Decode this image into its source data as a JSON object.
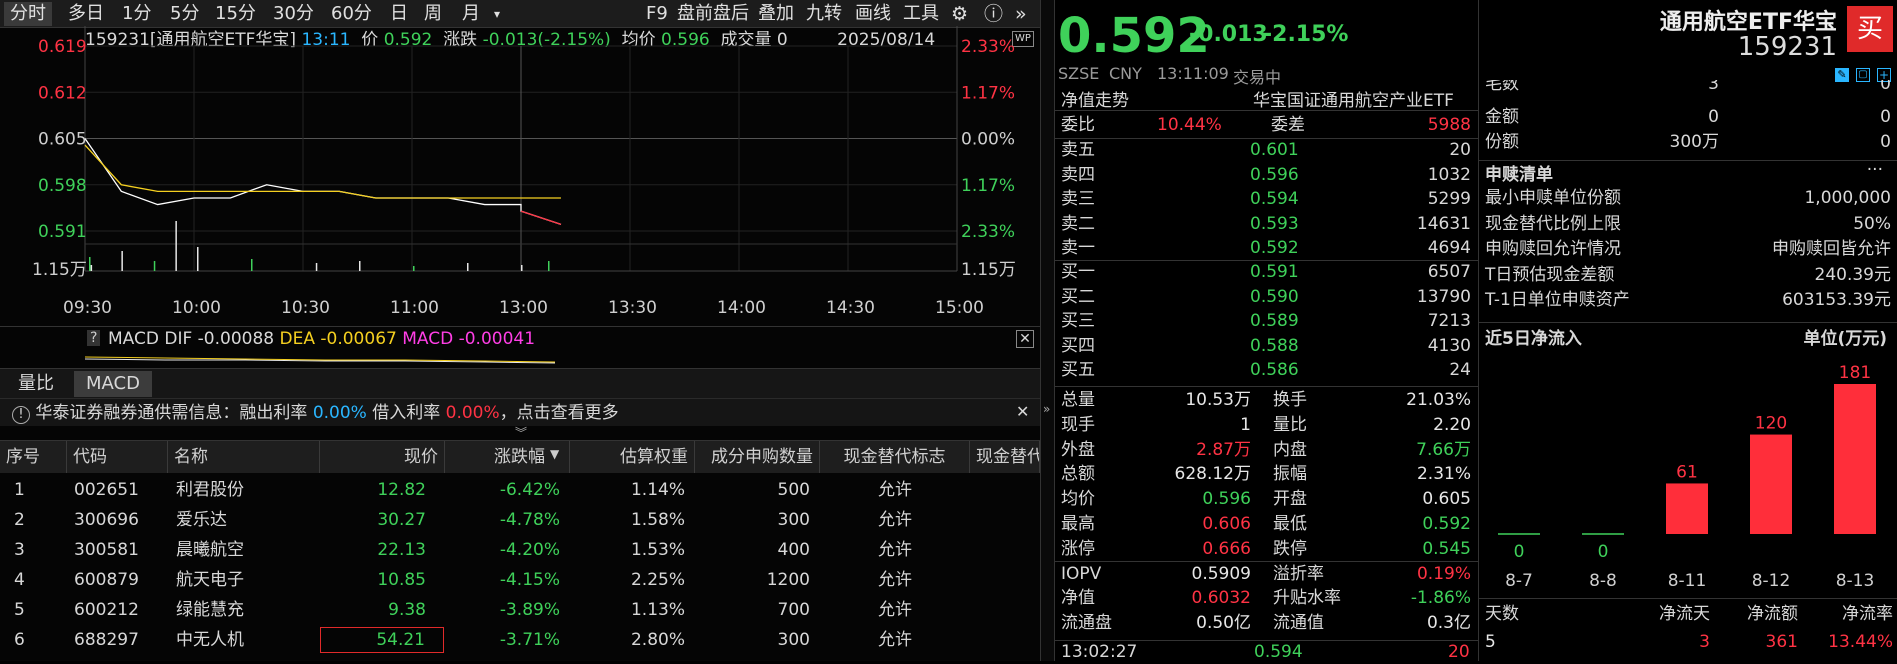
{
  "toolbar": {
    "periods": [
      "分时",
      "多日",
      "1分",
      "5分",
      "15分",
      "30分",
      "60分",
      "日",
      "周",
      "月"
    ],
    "menu_caret": "▾",
    "tools": [
      "F9",
      "盘前盘后",
      "叠加",
      "九转",
      "画线",
      "工具"
    ]
  },
  "info": {
    "code_name": "159231[通用航空ETF华宝]",
    "time": "13:11",
    "price_label": "价",
    "price": "0.592",
    "change_label": "涨跌",
    "change": "-0.013(-2.15%)",
    "avg_label": "均价",
    "avg": "0.596",
    "vol_label": "成交量",
    "vol": "0",
    "date": "2025/08/14",
    "wp": "WP"
  },
  "axes": {
    "left_ticks": [
      "0.619",
      "0.612",
      "0.605",
      "0.598",
      "0.591"
    ],
    "right_ticks": [
      "2.33%",
      "1.17%",
      "0.00%",
      "1.17%",
      "2.33%"
    ],
    "vol_label": "1.15万",
    "time_ticks": [
      "09:30",
      "10:00",
      "10:30",
      "11:00",
      "13:00",
      "13:30",
      "14:00",
      "14:30",
      "15:00"
    ]
  },
  "chart_data": {
    "type": "line",
    "title": "",
    "xlabel": "",
    "ylabel": "",
    "ylim": [
      0.591,
      0.619
    ],
    "x": [
      "09:30",
      "09:40",
      "09:50",
      "10:00",
      "10:10",
      "10:20",
      "10:30",
      "10:40",
      "10:50",
      "11:00",
      "11:10",
      "11:20",
      "11:30",
      "13:00",
      "13:11"
    ],
    "series": [
      {
        "name": "价",
        "values": [
          0.605,
          0.597,
          0.595,
          0.596,
          0.596,
          0.598,
          0.597,
          0.597,
          0.596,
          0.596,
          0.596,
          0.595,
          0.595,
          0.594,
          0.592
        ]
      },
      {
        "name": "均价",
        "values": [
          0.604,
          0.598,
          0.597,
          0.597,
          0.597,
          0.597,
          0.597,
          0.597,
          0.596,
          0.596,
          0.596,
          0.596,
          0.596,
          0.596,
          0.596
        ]
      }
    ]
  },
  "macd": {
    "label": "MACD",
    "dif_label": "DIF",
    "dif": "-0.00088",
    "dea_label": "DEA",
    "dea": "-0.00067",
    "macd_label": "MACD",
    "macd": "-0.00041"
  },
  "tabs": [
    "量比",
    "MACD"
  ],
  "notice": {
    "prefix": "华泰证券融券通供需信息：融出利率",
    "rate1": "0.00%",
    "mid": "借入利率",
    "rate2": "0.00%",
    "suffix": "，点击查看更多"
  },
  "table": {
    "headers": [
      "序号",
      "代码",
      "名称",
      "现价",
      "涨跌幅",
      "估算权重",
      "成分申购数量",
      "现金替代标志",
      "现金替代"
    ],
    "rows": [
      [
        "1",
        "002651",
        "利君股份",
        "12.82",
        "-6.42%",
        "1.14%",
        "500",
        "允许"
      ],
      [
        "2",
        "300696",
        "爱乐达",
        "30.27",
        "-4.78%",
        "1.58%",
        "300",
        "允许"
      ],
      [
        "3",
        "300581",
        "晨曦航空",
        "22.13",
        "-4.20%",
        "1.53%",
        "400",
        "允许"
      ],
      [
        "4",
        "600879",
        "航天电子",
        "10.85",
        "-4.15%",
        "2.25%",
        "1200",
        "允许"
      ],
      [
        "5",
        "600212",
        "绿能慧充",
        "9.38",
        "-3.89%",
        "1.13%",
        "700",
        "允许"
      ],
      [
        "6",
        "688297",
        "中无人机",
        "54.21",
        "-3.71%",
        "2.80%",
        "300",
        "允许"
      ]
    ]
  },
  "quote": {
    "price": "0.592",
    "change": "-0.013",
    "pct": "-2.15%",
    "name": "通用航空ETF华宝",
    "code": "159231",
    "buy_label": "买",
    "exchange": "SZSE",
    "currency": "CNY",
    "time": "13:11:09",
    "status": "交易中",
    "nav_trend": "净值走势",
    "fund_full": "华宝国证通用航空产业ETF"
  },
  "orderbook": {
    "wb_label": "委比",
    "wb": "10.44%",
    "wc_label": "委差",
    "wc": "5988",
    "asks": [
      [
        "卖五",
        "0.601",
        "20"
      ],
      [
        "卖四",
        "0.596",
        "1032"
      ],
      [
        "卖三",
        "0.594",
        "5299"
      ],
      [
        "卖二",
        "0.593",
        "14631"
      ],
      [
        "卖一",
        "0.592",
        "4694"
      ]
    ],
    "bids": [
      [
        "买一",
        "0.591",
        "6507"
      ],
      [
        "买二",
        "0.590",
        "13790"
      ],
      [
        "买三",
        "0.589",
        "7213"
      ],
      [
        "买四",
        "0.588",
        "4130"
      ],
      [
        "买五",
        "0.586",
        "24"
      ]
    ]
  },
  "stats": [
    [
      "总量",
      "10.53万",
      "换手",
      "21.03%"
    ],
    [
      "现手",
      "1",
      "量比",
      "2.20"
    ],
    [
      "外盘",
      "2.87万",
      "内盘",
      "7.66万"
    ],
    [
      "总额",
      "628.12万",
      "振幅",
      "2.31%"
    ],
    [
      "均价",
      "0.596",
      "开盘",
      "0.605"
    ],
    [
      "最高",
      "0.606",
      "最低",
      "0.592"
    ],
    [
      "涨停",
      "0.666",
      "跌停",
      "0.545"
    ],
    [
      "IOPV",
      "0.5909",
      "溢折率",
      "0.19%"
    ],
    [
      "净值",
      "0.6032",
      "升贴水率",
      "-1.86%"
    ],
    [
      "流通盘",
      "0.50亿",
      "流通值",
      "0.3亿"
    ]
  ],
  "tick": {
    "time": "13:02:27",
    "price": "0.594",
    "vol": "20"
  },
  "redeem_top": [
    [
      "毛数",
      "3",
      "0"
    ],
    [
      "金额",
      "0",
      "0"
    ],
    [
      "份额",
      "300万",
      "0"
    ]
  ],
  "redeem": {
    "title": "申赎清单",
    "more": "···",
    "items": [
      [
        "最小申赎单位份额",
        "1,000,000"
      ],
      [
        "现金替代比例上限",
        "50%"
      ],
      [
        "申购赎回允许情况",
        "申购赎回皆允许"
      ],
      [
        "T日预估现金差额",
        "240.39元"
      ],
      [
        "T-1日单位申赎资产",
        "603153.39元"
      ]
    ]
  },
  "flow": {
    "title": "近5日净流入",
    "unit": "单位(万元)",
    "days": [
      "8-7",
      "8-8",
      "8-11",
      "8-12",
      "8-13"
    ],
    "values": [
      0,
      0,
      61,
      120,
      181
    ],
    "value_labels": [
      "0",
      "0",
      "61",
      "120",
      "181"
    ],
    "footer_headers": [
      "天数",
      "净流天",
      "净流额",
      "净流率"
    ],
    "footer_values": [
      "5",
      "3",
      "361",
      "13.44%"
    ]
  },
  "colors": {
    "up": "#ff3344",
    "down": "#3fd15a",
    "avg": "#f5d020",
    "bar": "#ff2e3a"
  }
}
